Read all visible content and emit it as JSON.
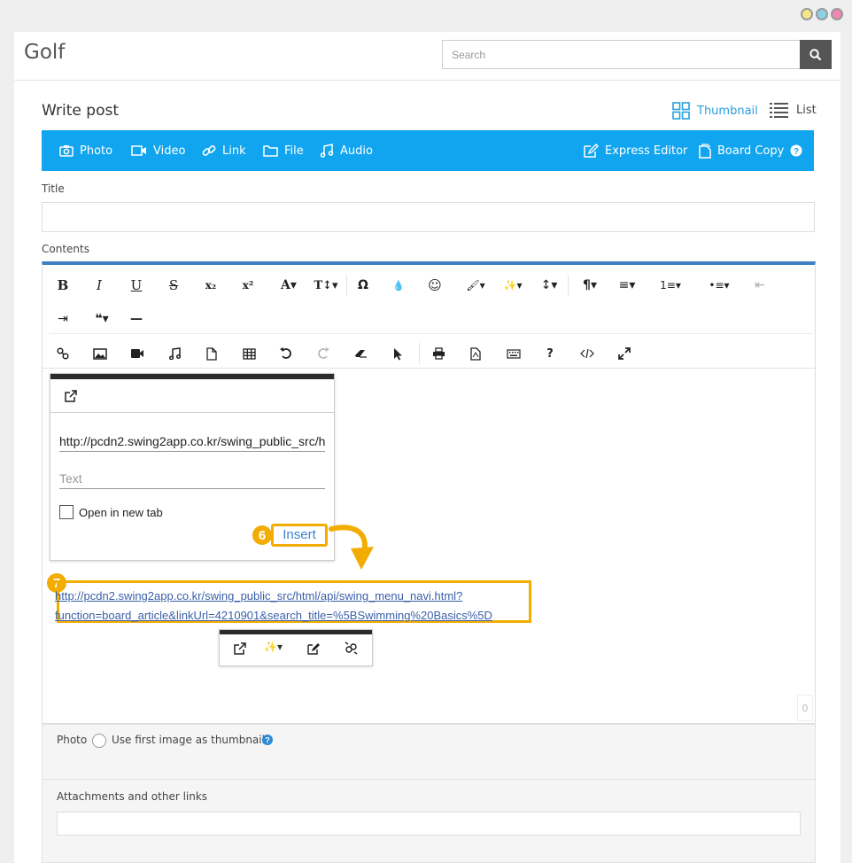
{
  "window_controls": {
    "colors": [
      "#f5e48a",
      "#8ad3e6",
      "#ef86b5"
    ]
  },
  "header": {
    "brand": "Golf",
    "search_placeholder": "Search"
  },
  "page": {
    "title": "Write post",
    "views": [
      {
        "label": "Thumbnail",
        "icon": "grid-icon",
        "active": true
      },
      {
        "label": "List",
        "icon": "list-icon",
        "active": false
      }
    ]
  },
  "media_bar": {
    "left": [
      {
        "label": "Photo",
        "icon": "camera-icon"
      },
      {
        "label": "Video",
        "icon": "video-icon"
      },
      {
        "label": "Link",
        "icon": "link-icon"
      },
      {
        "label": "File",
        "icon": "folder-icon"
      },
      {
        "label": "Audio",
        "icon": "music-icon"
      }
    ],
    "right": [
      {
        "label": "Express Editor",
        "icon": "edit-icon"
      },
      {
        "label": "Board Copy",
        "icon": "copy-icon"
      }
    ],
    "color": "#11a5ef"
  },
  "form": {
    "title_label": "Title",
    "contents_label": "Contents"
  },
  "toolbar": {
    "row1": [
      "B",
      "I",
      "U",
      "S",
      "x₂",
      "x²",
      "A▾",
      "T↕▾",
      "Ω",
      "💧",
      "☺",
      "🖌▾",
      "✨▾",
      "↕▾",
      "¶▾",
      "≡▾",
      "1≡▾",
      "•≡▾",
      "⇤"
    ],
    "row2": [
      "⇥",
      "❝▾",
      "—"
    ],
    "row3": [
      "link-icon",
      "image-icon",
      "video-icon",
      "music-icon",
      "file-icon",
      "table-icon",
      "undo-icon",
      "redo-icon",
      "eraser-icon",
      "pointer-icon",
      "print-icon",
      "pdf-icon",
      "keyboard-icon",
      "help-icon",
      "code-icon",
      "fullscreen-icon"
    ]
  },
  "link_popover": {
    "url": "http://pcdn2.swing2app.co.kr/swing_public_src/h",
    "text_placeholder": "Text",
    "open_new_tab": "Open in new tab",
    "insert": "Insert",
    "step": "6"
  },
  "inserted_link": {
    "step": "7",
    "line1": "http://pcdn2.swing2app.co.kr/swing_public_src/html/api/swing_menu_navi.html?",
    "line2": "function=board_article&linkUrl=4210901&search_title=%5BSwimming%20Basics%5D"
  },
  "editor": {
    "counter": "0"
  },
  "options": {
    "photo_label": "Photo",
    "thumb_label": "Use first image as thumbnail",
    "attachments_label": "Attachments and other links"
  },
  "accent": "#f2ad00"
}
